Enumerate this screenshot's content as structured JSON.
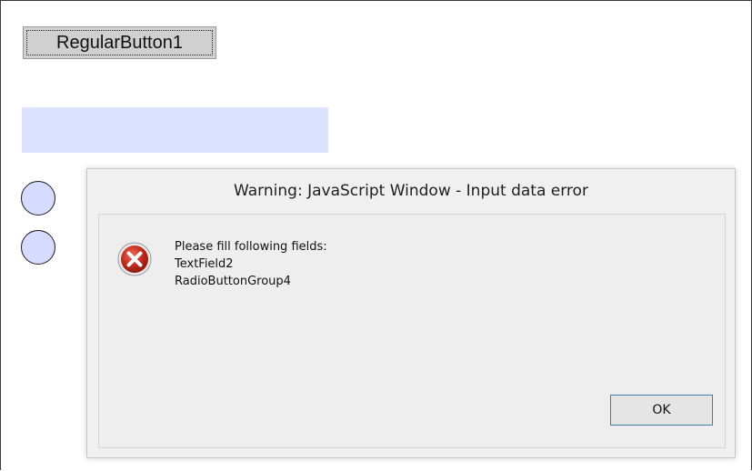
{
  "form": {
    "regular_button_label": "RegularButton1",
    "text_field_value": "",
    "colors": {
      "field_background": "#dde3ff",
      "radio_fill": "#d6dcff",
      "button_background": "#d0d0d0"
    }
  },
  "dialog": {
    "title": "Warning: JavaScript Window - Input data error",
    "icon": "error-icon",
    "message_lines": [
      "Please fill following fields:",
      "TextField2",
      "RadioButtonGroup4"
    ],
    "ok_label": "OK",
    "colors": {
      "background": "#f0f0f0",
      "ok_border": "#3c7fb1",
      "icon_red": "#c42b1c"
    }
  }
}
